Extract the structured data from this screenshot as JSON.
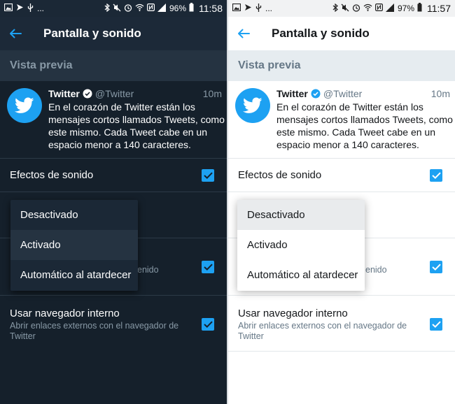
{
  "status_dark": {
    "battery": "96%",
    "time": "11:58",
    "overflow": "..."
  },
  "status_light": {
    "battery": "97%",
    "time": "11:57",
    "overflow": "..."
  },
  "appbar": {
    "title": "Pantalla y sonido"
  },
  "preview": {
    "header": "Vista previa"
  },
  "tweet": {
    "name": "Twitter",
    "handle": "@Twitter",
    "time": "10m",
    "text": "En el corazón de Twitter están los mensajes cortos llamados Tweets, como este mismo. Cada Tweet cabe en un espacio menor a 140 caracteres."
  },
  "settings": {
    "sound_effects": "Efectos de sonido",
    "media_partial": "enido",
    "in_app_browser": "Usar navegador interno",
    "in_app_browser_desc": "Abrir enlaces externos con el navegador de Twitter"
  },
  "dropdown": {
    "options": [
      "Desactivado",
      "Activado",
      "Automático al atardecer"
    ],
    "selected_dark": "Activado",
    "selected_light": "Desactivado"
  },
  "colors": {
    "accent": "#1da1f2",
    "dark_background": "#15202b",
    "dark_section": "#253341",
    "light_section": "#e6ecf0"
  },
  "icons": {
    "back": "arrow-left-icon",
    "avatar": "twitter-bird-icon",
    "verified": "verified-badge-icon",
    "checkbox": "checkmark-icon"
  }
}
